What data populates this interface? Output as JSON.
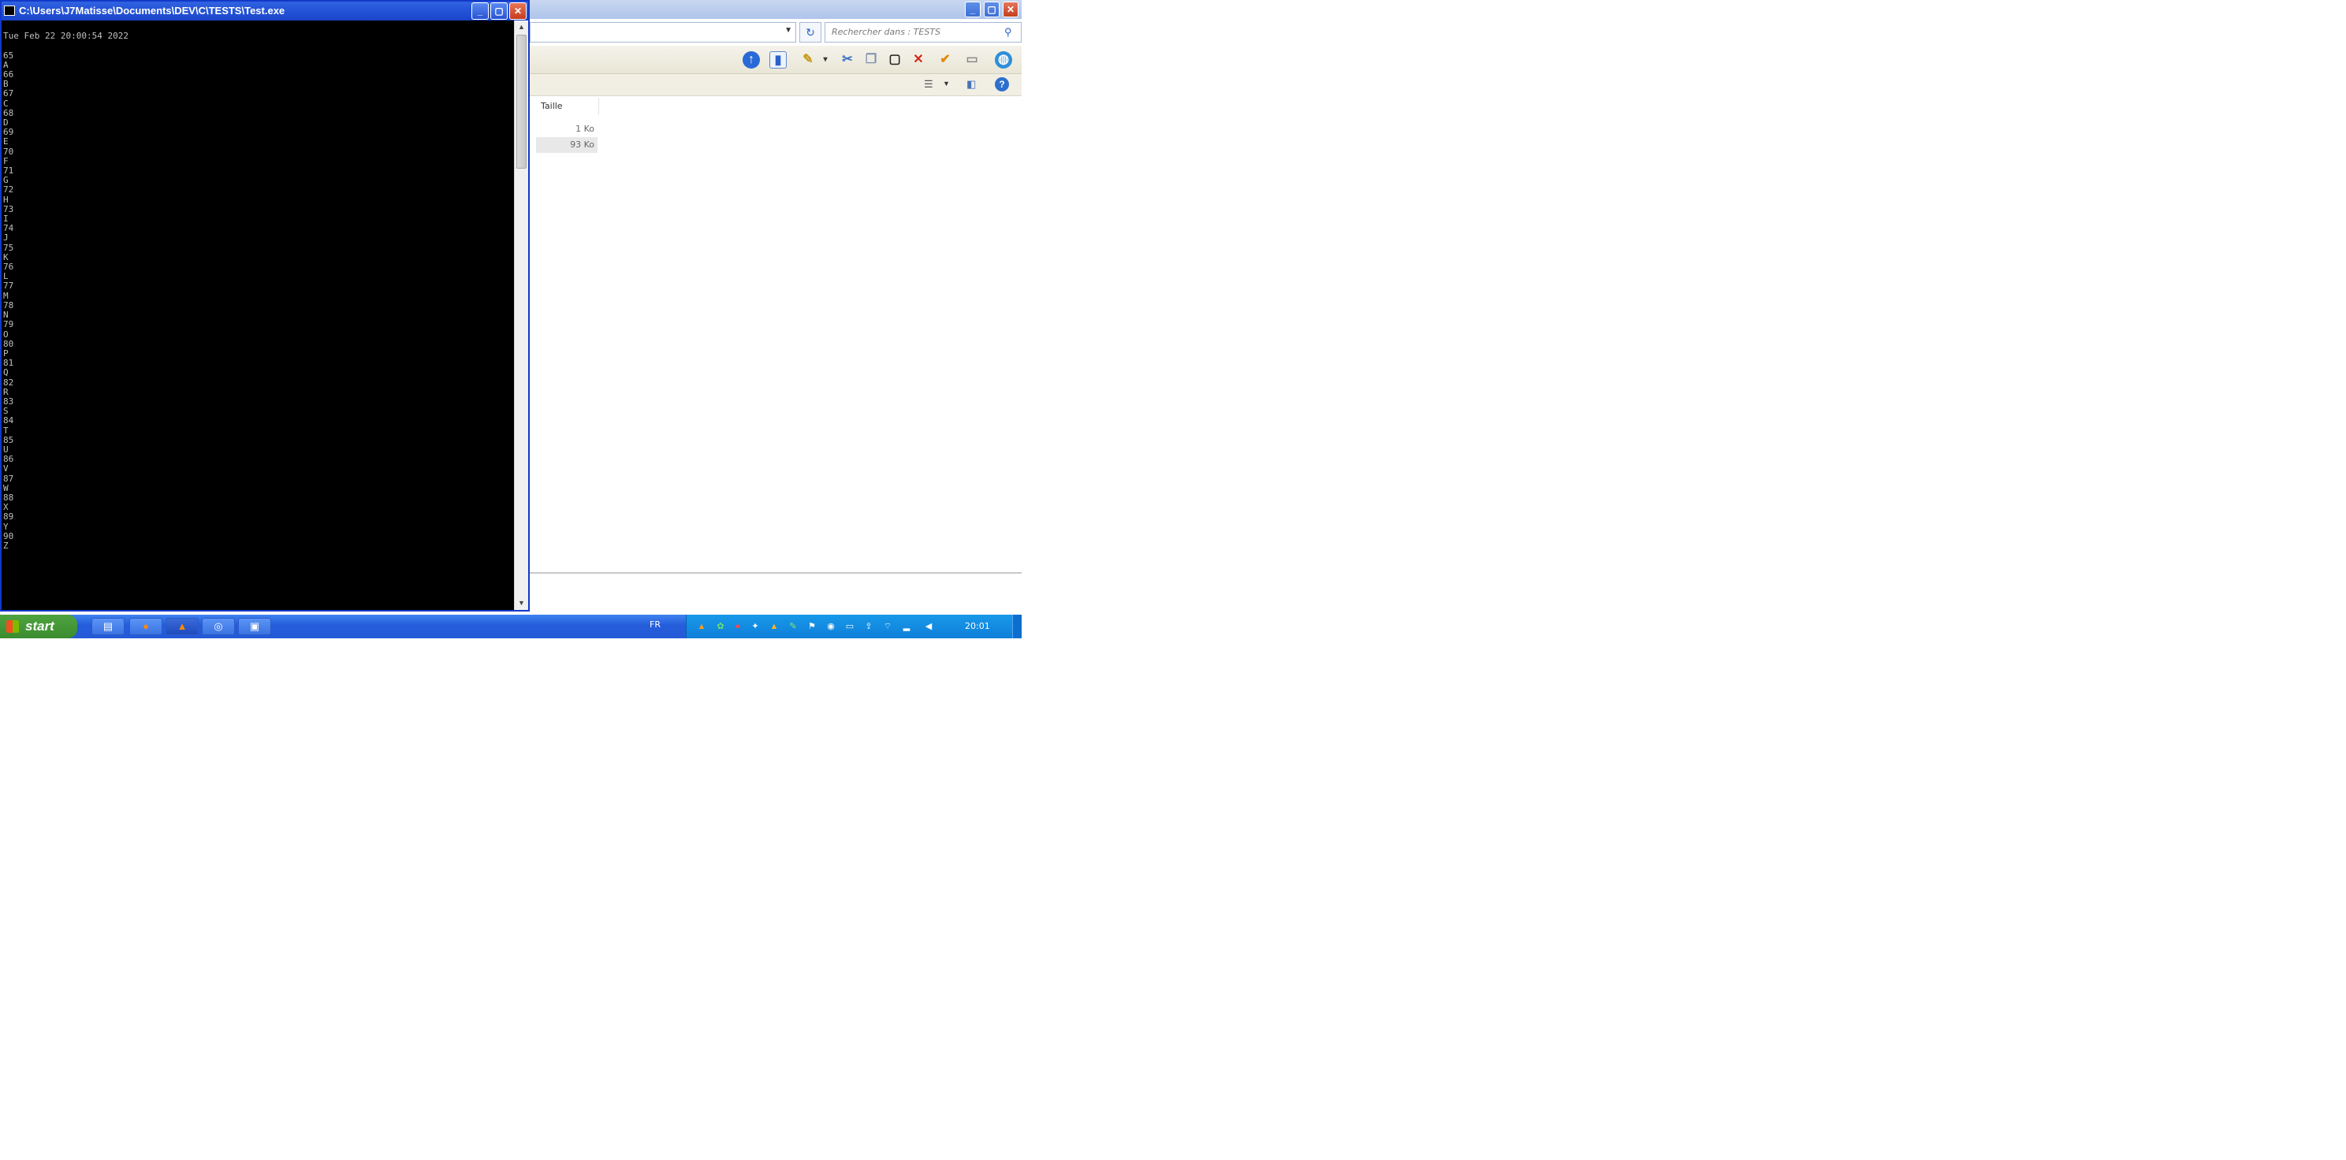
{
  "explorer": {
    "search_placeholder": "Rechercher dans : TESTS",
    "column_header": "Taille",
    "files": [
      {
        "size": "1 Ko"
      },
      {
        "size": "93 Ko"
      }
    ],
    "toolbar_icons": [
      "back-arrow-icon",
      "view-pane-icon",
      "pen-icon",
      "scissors-icon",
      "copy-icon",
      "blank-page-icon",
      "delete-x-icon",
      "check-icon",
      "properties-icon",
      "globe-icon"
    ]
  },
  "console": {
    "title": "C:\\Users\\J7Matisse\\Documents\\DEV\\C\\TESTS\\Test.exe",
    "header_line": "Tue Feb 22 20:00:54 2022",
    "output": [
      "65",
      "A",
      "66",
      "B",
      "67",
      "C",
      "68",
      "D",
      "69",
      "E",
      "70",
      "F",
      "71",
      "G",
      "72",
      "H",
      "73",
      "I",
      "74",
      "J",
      "75",
      "K",
      "76",
      "L",
      "77",
      "M",
      "78",
      "N",
      "79",
      "O",
      "80",
      "P",
      "81",
      "Q",
      "82",
      "R",
      "83",
      "S",
      "84",
      "T",
      "85",
      "U",
      "86",
      "V",
      "87",
      "W",
      "88",
      "X",
      "89",
      "Y",
      "90",
      "Z"
    ]
  },
  "taskbar": {
    "start_label": "start",
    "language": "FR",
    "clock": "20:01"
  },
  "colors": {
    "console_bg": "#000000",
    "console_text": "#c0c0c0",
    "taskbar_blue": "#245ddb",
    "start_green": "#3b8c2f"
  }
}
